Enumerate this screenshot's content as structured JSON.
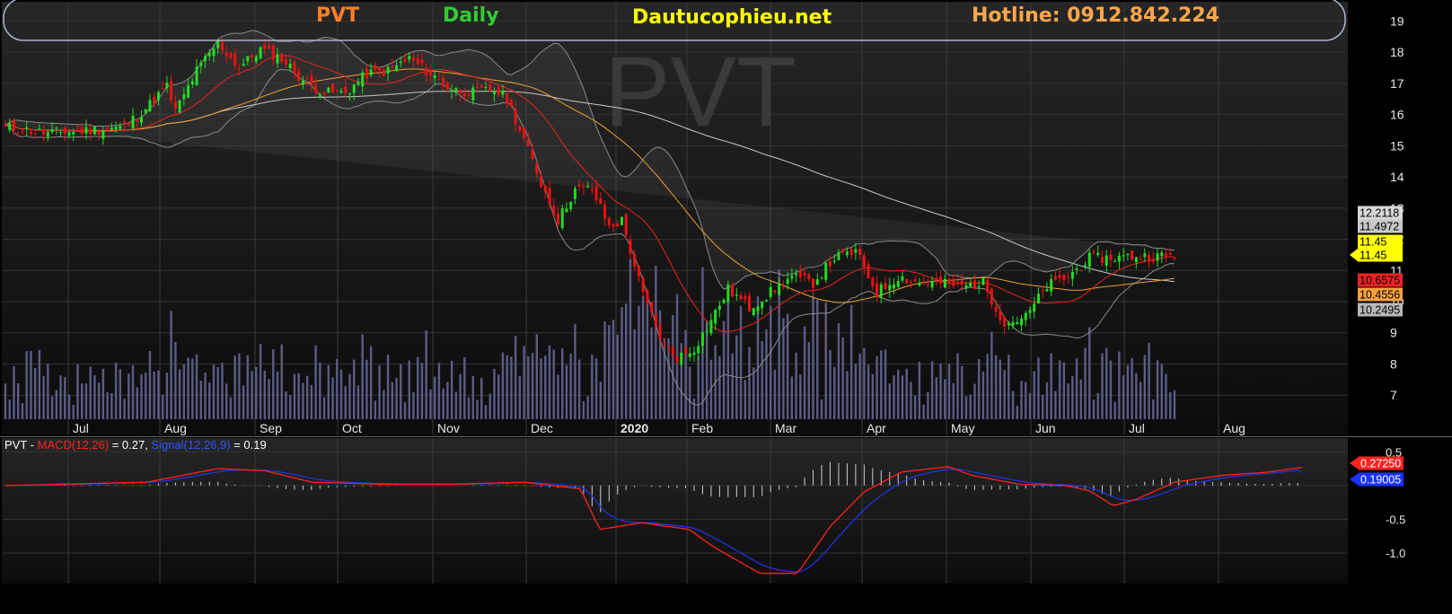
{
  "header": {
    "symbol": "PVT",
    "period": "Daily",
    "site": "Dautucophieu.net",
    "hotline": "Hotline: 0912.842.224",
    "watermark": "PVT"
  },
  "colors": {
    "symbol": "#ff7f2a",
    "period": "#33cc33",
    "site": "#ffff00",
    "hotline": "#ffa64d",
    "up_candle": "#22dd22",
    "down_candle": "#ee1111",
    "ma_red": "#ee2222",
    "ma_orange": "#f0a030",
    "ma_long": "#c8c8c8",
    "bollinger": "#8a8a8a",
    "volume": "#5c5c88",
    "macd": "#ff2222",
    "signal": "#2233dd",
    "histogram": "#d0d0d0"
  },
  "price_axis": {
    "ticks": [
      "19",
      "18",
      "17",
      "16",
      "15",
      "14",
      "13",
      "12",
      "11",
      "10",
      "9",
      "8",
      "7"
    ],
    "range": [
      6.2,
      19.3
    ]
  },
  "x_axis": {
    "labels": [
      "Jul",
      "Aug",
      "Sep",
      "Oct",
      "Nov",
      "Dec",
      "2020",
      "Feb",
      "Mar",
      "Apr",
      "May",
      "Jun",
      "Jul",
      "Aug"
    ],
    "bold_label": "2020"
  },
  "value_tags": [
    {
      "value": "12.2118",
      "bg": "#d8d8d8",
      "fg": "#000000"
    },
    {
      "value": "11.4972",
      "bg": "#c8c8c8",
      "fg": "#000000"
    },
    {
      "value": "11.45",
      "bg": "#ffff00",
      "fg": "#000000"
    },
    {
      "value": "11.45",
      "bg": "#ffff00",
      "fg": "#000000"
    },
    {
      "value": "10.6575",
      "bg": "#ee2222",
      "fg": "#000000"
    },
    {
      "value": "10.4556",
      "bg": "#f5a040",
      "fg": "#000000"
    },
    {
      "value": "10.2495",
      "bg": "#b8b8b8",
      "fg": "#000000"
    }
  ],
  "macd": {
    "label_prefix": "PVT - ",
    "macd_label": "MACD(12,26)",
    "macd_value": " = 0.27, ",
    "signal_label": "Signal(12,26,9)",
    "signal_value": " = 0.19",
    "axis_ticks": [
      "0.5",
      "-0.5",
      "-1.0"
    ],
    "range": [
      -1.45,
      0.65
    ],
    "tag_macd": "0.27250",
    "tag_signal": "0.19005"
  },
  "chart_data": {
    "type": "candlestick",
    "symbol": "PVT",
    "interval": "daily",
    "date_span": "Jun 2019 – Aug 2020",
    "close_anchors": {
      "x_days": [
        0,
        10,
        20,
        28,
        33,
        38,
        40,
        45,
        50,
        55,
        60,
        65,
        70,
        75,
        80,
        85,
        90,
        95,
        100,
        105,
        110,
        115,
        118,
        122,
        126,
        130,
        134,
        138,
        142,
        145,
        150,
        155,
        158,
        162,
        166,
        170,
        175,
        180,
        185,
        190,
        195,
        200,
        205,
        210,
        215,
        220,
        225,
        230,
        235,
        240,
        245,
        250,
        255,
        260,
        265,
        270,
        275,
        280,
        285,
        290,
        295,
        300,
        305
      ],
      "close": [
        15.6,
        15.4,
        15.5,
        15.6,
        16.2,
        16.9,
        16.1,
        17.4,
        18.3,
        17.5,
        18.1,
        17.8,
        17.1,
        16.7,
        16.7,
        17.3,
        17.4,
        17.8,
        17.3,
        16.8,
        16.7,
        16.8,
        16.5,
        15.2,
        13.8,
        12.6,
        13.6,
        13.6,
        12.4,
        12.6,
        10.2,
        8.6,
        8.2,
        8.5,
        9.4,
        10.4,
        9.8,
        10.3,
        10.8,
        10.6,
        11.4,
        11.6,
        10.3,
        10.8,
        10.6,
        10.6,
        10.5,
        10.6,
        9.3,
        9.5,
        10.5,
        10.8,
        11.4,
        11.4,
        11.45,
        11.45,
        11.45
      ],
      "units": "VND thousand"
    },
    "indicators": {
      "ma_red_last": 10.6575,
      "ma_orange_last": 10.4556,
      "ma_long_last": 11.4972,
      "bollinger_upper_last": 12.2118,
      "bollinger_lower_last": 10.2495,
      "last_close": 11.45
    },
    "macd": {
      "fast": 12,
      "slow": 26,
      "signal": 9,
      "macd_last": 0.27,
      "signal_last": 0.19,
      "macd_path_points": {
        "x_days": [
          0,
          30,
          45,
          55,
          65,
          80,
          95,
          110,
          122,
          126,
          135,
          145,
          150,
          160,
          168,
          175,
          182,
          190,
          200,
          205,
          215,
          225,
          230,
          235,
          240,
          248,
          258,
          268,
          275
        ],
        "macd": [
          0.0,
          0.05,
          0.25,
          0.22,
          0.05,
          0.02,
          0.02,
          0.05,
          -0.05,
          -0.65,
          -0.55,
          -0.65,
          -0.9,
          -1.3,
          -1.3,
          -0.6,
          -0.1,
          0.2,
          0.28,
          0.15,
          0.02,
          0.0,
          -0.08,
          -0.3,
          -0.2,
          0.05,
          0.15,
          0.2,
          0.27
        ]
      }
    },
    "volume_range": [
      0,
      2.7
    ]
  }
}
